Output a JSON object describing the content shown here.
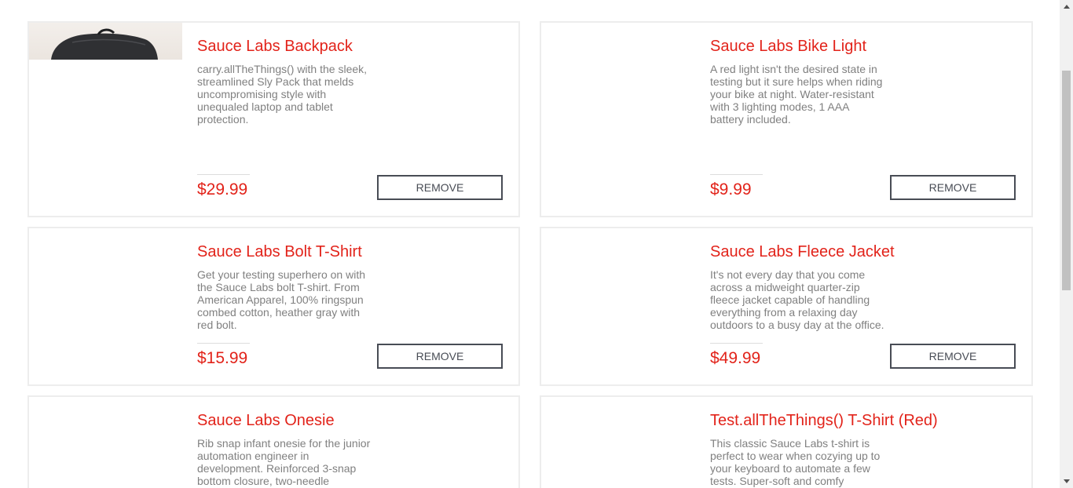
{
  "cart_items": [
    {
      "title": "Sauce Labs Backpack",
      "description": "carry.allTheThings() with the sleek, streamlined Sly Pack that melds uncompromising style with unequaled laptop and tablet protection.",
      "price": "$29.99",
      "button": "Remove"
    },
    {
      "title": "Sauce Labs Bike Light",
      "description": "A red light isn't the desired state in testing but it sure helps when riding your bike at night. Water-resistant with 3 lighting modes, 1 AAA battery included.",
      "price": "$9.99",
      "button": "Remove"
    },
    {
      "title": "Sauce Labs Bolt T-Shirt",
      "description": "Get your testing superhero on with the Sauce Labs bolt T-shirt. From American Apparel, 100% ringspun combed cotton, heather gray with red bolt.",
      "price": "$15.99",
      "button": "Remove"
    },
    {
      "title": "Sauce Labs Fleece Jacket",
      "description": "It's not every day that you come across a midweight quarter-zip fleece jacket capable of handling everything from a relaxing day outdoors to a busy day at the office.",
      "price": "$49.99",
      "button": "Remove"
    },
    {
      "title": "Sauce Labs Onesie",
      "description": "Rib snap infant onesie for the junior automation engineer in development. Reinforced 3-snap bottom closure, two-needle",
      "price": "",
      "button": ""
    },
    {
      "title": "Test.allTheThings() T-Shirt (Red)",
      "description": "This classic Sauce Labs t-shirt is perfect to wear when cozying up to your keyboard to automate a few tests. Super-soft and comfy",
      "price": "",
      "button": ""
    }
  ],
  "scrollbar": {
    "up_icon": "triangle-up-icon",
    "down_icon": "triangle-down-icon"
  },
  "colors": {
    "accent": "#e2231a",
    "button_border": "#484c55",
    "text_muted": "#808080"
  }
}
